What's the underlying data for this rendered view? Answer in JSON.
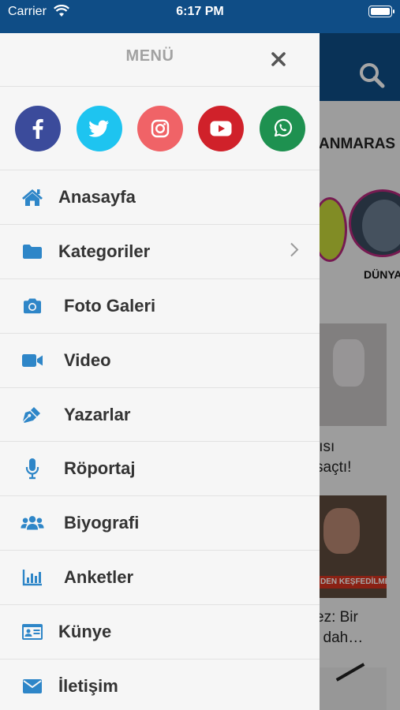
{
  "status_bar": {
    "carrier": "Carrier",
    "time": "6:17 PM"
  },
  "background": {
    "ticker": "ANMARAS",
    "story_label": "DÜNYA",
    "article1_text_line1": "lısı",
    "article1_text_line2": "saçtı!",
    "article2_caption": "DEN KEŞFEDİLME",
    "article2_text_line1": "ez: Bir",
    "article2_text_line2": "i dah…"
  },
  "drawer": {
    "title": "MENÜ",
    "social": [
      {
        "name": "facebook",
        "color": "#3b4b9b"
      },
      {
        "name": "twitter",
        "color": "#1ec4f0"
      },
      {
        "name": "instagram",
        "color": "#f06367"
      },
      {
        "name": "youtube",
        "color": "#d0212a"
      },
      {
        "name": "whatsapp",
        "color": "#1e9150"
      }
    ],
    "items": [
      {
        "label": "Anasayfa",
        "icon": "home-icon"
      },
      {
        "label": "Kategoriler",
        "icon": "folder-icon"
      },
      {
        "label": "Foto Galeri",
        "icon": "camera-icon"
      },
      {
        "label": "Video",
        "icon": "video-icon"
      },
      {
        "label": "Yazarlar",
        "icon": "pen-icon"
      },
      {
        "label": "Röportaj",
        "icon": "microphone-icon"
      },
      {
        "label": "Biyografi",
        "icon": "users-icon"
      },
      {
        "label": "Anketler",
        "icon": "bar-chart-icon"
      },
      {
        "label": "Künye",
        "icon": "id-card-icon"
      },
      {
        "label": "İletişim",
        "icon": "envelope-icon"
      }
    ]
  },
  "colors": {
    "header_blue": "#0f4d86",
    "icon_blue": "#2e86c8",
    "label_dark": "#333333",
    "title_grey": "#a2a2a2"
  }
}
